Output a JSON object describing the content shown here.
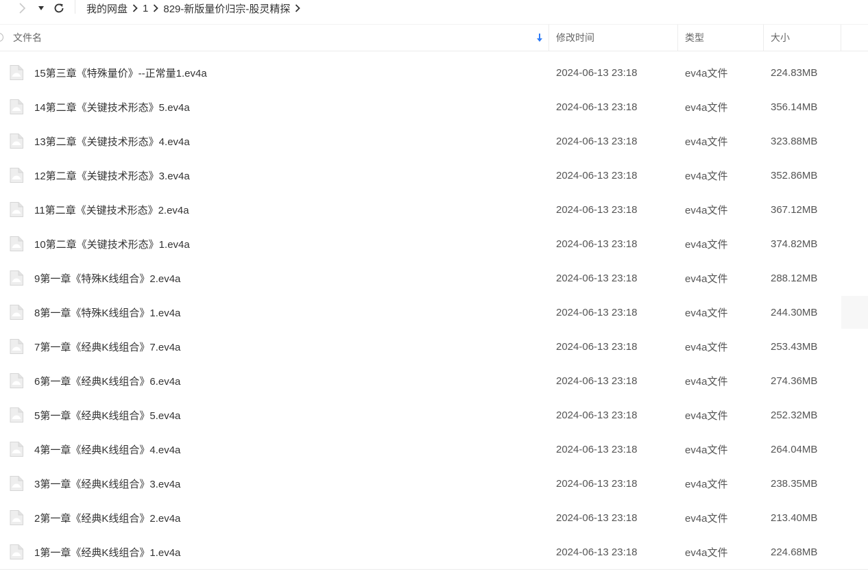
{
  "breadcrumb": [
    {
      "label": "我的网盘"
    },
    {
      "label": "1"
    },
    {
      "label": "829-新版量价归宗-股灵精探"
    }
  ],
  "columns": {
    "name": "文件名",
    "time": "修改时间",
    "type": "类型",
    "size": "大小"
  },
  "files": [
    {
      "name": "15第三章《特殊量价》--正常量1.ev4a",
      "time": "2024-06-13 23:18",
      "type": "ev4a文件",
      "size": "224.83MB"
    },
    {
      "name": "14第二章《关键技术形态》5.ev4a",
      "time": "2024-06-13 23:18",
      "type": "ev4a文件",
      "size": "356.14MB"
    },
    {
      "name": "13第二章《关键技术形态》4.ev4a",
      "time": "2024-06-13 23:18",
      "type": "ev4a文件",
      "size": "323.88MB"
    },
    {
      "name": "12第二章《关键技术形态》3.ev4a",
      "time": "2024-06-13 23:18",
      "type": "ev4a文件",
      "size": "352.86MB"
    },
    {
      "name": "11第二章《关键技术形态》2.ev4a",
      "time": "2024-06-13 23:18",
      "type": "ev4a文件",
      "size": "367.12MB"
    },
    {
      "name": "10第二章《关键技术形态》1.ev4a",
      "time": "2024-06-13 23:18",
      "type": "ev4a文件",
      "size": "374.82MB"
    },
    {
      "name": "9第一章《特殊K线组合》2.ev4a",
      "time": "2024-06-13 23:18",
      "type": "ev4a文件",
      "size": "288.12MB"
    },
    {
      "name": "8第一章《特殊K线组合》1.ev4a",
      "time": "2024-06-13 23:18",
      "type": "ev4a文件",
      "size": "244.30MB"
    },
    {
      "name": "7第一章《经典K线组合》7.ev4a",
      "time": "2024-06-13 23:18",
      "type": "ev4a文件",
      "size": "253.43MB"
    },
    {
      "name": "6第一章《经典K线组合》6.ev4a",
      "time": "2024-06-13 23:18",
      "type": "ev4a文件",
      "size": "274.36MB"
    },
    {
      "name": "5第一章《经典K线组合》5.ev4a",
      "time": "2024-06-13 23:18",
      "type": "ev4a文件",
      "size": "252.32MB"
    },
    {
      "name": "4第一章《经典K线组合》4.ev4a",
      "time": "2024-06-13 23:18",
      "type": "ev4a文件",
      "size": "264.04MB"
    },
    {
      "name": "3第一章《经典K线组合》3.ev4a",
      "time": "2024-06-13 23:18",
      "type": "ev4a文件",
      "size": "238.35MB"
    },
    {
      "name": "2第一章《经典K线组合》2.ev4a",
      "time": "2024-06-13 23:18",
      "type": "ev4a文件",
      "size": "213.40MB"
    },
    {
      "name": "1第一章《经典K线组合》1.ev4a",
      "time": "2024-06-13 23:18",
      "type": "ev4a文件",
      "size": "224.68MB"
    }
  ],
  "icons": {
    "forward": "chevron-right-icon",
    "history": "caret-down-icon",
    "refresh": "refresh-icon",
    "sort": "sort-arrow-down-icon",
    "file": "file-icon"
  },
  "colors": {
    "sort_arrow": "#2f7cf6"
  }
}
